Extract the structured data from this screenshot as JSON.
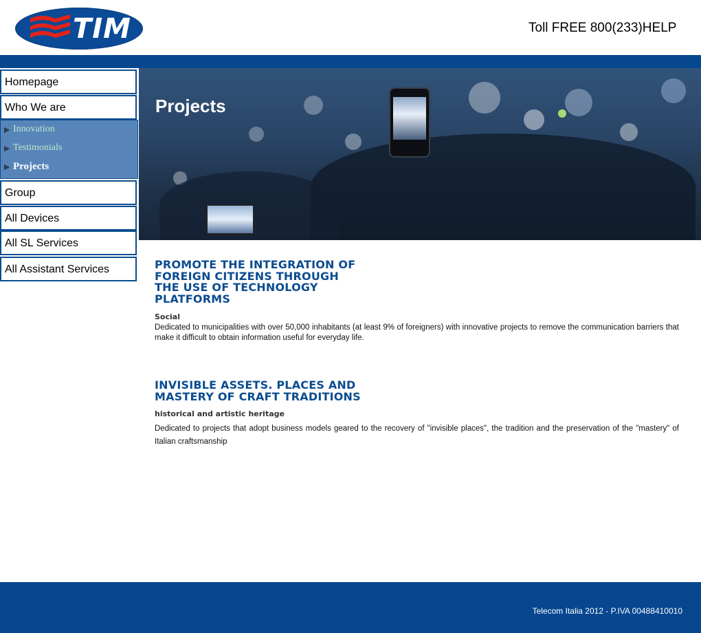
{
  "header": {
    "logo_text": "TIM",
    "toll_free": "Toll FREE 800(233)HELP"
  },
  "sidebar": {
    "items": [
      {
        "label": "Homepage"
      },
      {
        "label": "Who We are"
      },
      {
        "label": "Group"
      },
      {
        "label": "All Devices"
      },
      {
        "label": "All SL Services"
      },
      {
        "label": "All Assistant Services"
      }
    ],
    "submenu": [
      {
        "label": "Innovation",
        "active": false
      },
      {
        "label": "Testimonials",
        "active": false
      },
      {
        "label": "Projects",
        "active": true
      }
    ],
    "arrow": "▶"
  },
  "hero": {
    "title": "Projects"
  },
  "sections": [
    {
      "title": "PROMOTE THE INTEGRATION OF FOREIGN CITIZENS THROUGH THE USE OF TECHNOLOGY PLATFORMS",
      "subtitle": "Social",
      "body": "Dedicated to municipalities with over 50,000 inhabitants (at least 9% of foreigners) with innovative projects to remove the communication barriers that make it difficult to obtain information useful for everyday life."
    },
    {
      "title": "INVISIBLE ASSETS. PLACES AND MASTERY OF CRAFT TRADITIONS",
      "subtitle": "historical and artistic heritage",
      "body": "Dedicated to projects that adopt business models geared to the recovery of \"invisible places\", the tradition and the preservation of the \"mastery\" of Italian craftsmanship"
    }
  ],
  "footer": {
    "text": "Telecom Italia 2012 - P.IVA 00488410010"
  },
  "colors": {
    "brand_blue": "#06478f",
    "submenu_blue": "#5785b9",
    "title_blue": "#0b4c91",
    "logo_red": "#e2231a"
  }
}
